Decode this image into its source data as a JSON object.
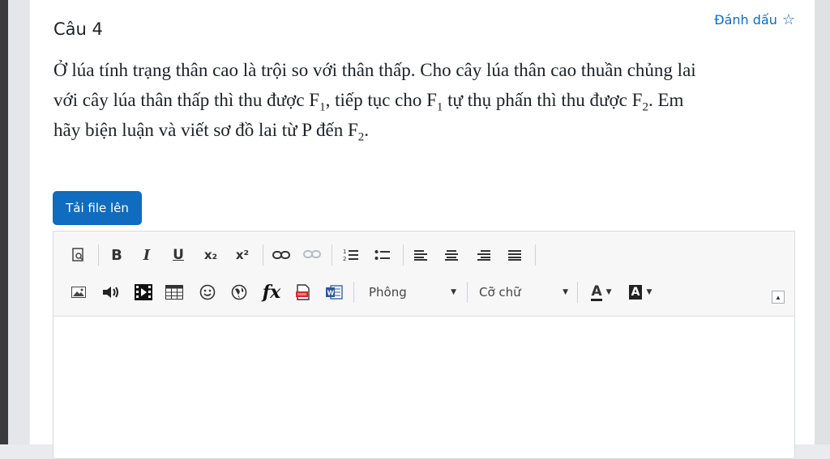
{
  "question": {
    "title": "Câu 4",
    "flag_label": "Đánh dấu",
    "text_line1": "Ở lúa tính trạng thân cao là trội so với thân thấp. Cho cây lúa thân cao thuần chủng lai",
    "text_line2_a": "với cây lúa thân thấp thì thu được F",
    "text_line2_b": ", tiếp tục cho F",
    "text_line2_c": " tự thụ phấn thì thu được F",
    "text_line2_d": ". Em",
    "text_line3_a": "hãy biện luận và viết sơ đồ lai từ P đến F",
    "text_line3_b": ".",
    "sub_1": "1",
    "sub_2": "2"
  },
  "upload": {
    "label": "Tải file lên"
  },
  "editor": {
    "toolbar_row1": {
      "bold": "B",
      "italic": "I",
      "underline": "U",
      "subscript": "x₂",
      "superscript": "x²"
    },
    "toolbar_row2": {
      "formula": "fx",
      "font_select": "Phông",
      "size_select": "Cỡ chữ",
      "text_color": "A",
      "bg_color": "A"
    },
    "icons": [
      "preview-icon",
      "link-icon",
      "unlink-icon",
      "ordered-list-icon",
      "unordered-list-icon",
      "align-left-icon",
      "align-center-icon",
      "align-right-icon",
      "justify-icon",
      "image-icon",
      "audio-icon",
      "video-icon",
      "table-icon",
      "emoji-icon",
      "globe-icon",
      "pdf-icon",
      "word-icon",
      "collapse-icon"
    ],
    "content": ""
  },
  "colors": {
    "accent": "#0f6cbf",
    "text": "#1d2125"
  }
}
